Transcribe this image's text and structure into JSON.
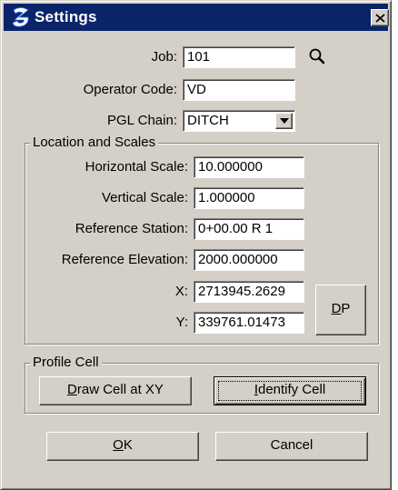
{
  "window": {
    "title": "Settings",
    "icon": "app-logo-icon",
    "close_icon": "close-icon"
  },
  "fields": {
    "job": {
      "label": "Job:",
      "value": "101",
      "icon": "search-icon"
    },
    "operator_code": {
      "label": "Operator Code:",
      "value": "VD"
    },
    "pgl_chain": {
      "label": "PGL Chain:",
      "value": "DITCH",
      "icon": "dropdown-arrow-icon"
    }
  },
  "location_and_scales": {
    "title": "Location and Scales",
    "horizontal_scale": {
      "label": "Horizontal Scale:",
      "value": "10.000000"
    },
    "vertical_scale": {
      "label": "Vertical Scale:",
      "value": "1.000000"
    },
    "reference_station": {
      "label": "Reference Station:",
      "value": "0+00.00 R 1"
    },
    "reference_elevation": {
      "label": "Reference Elevation:",
      "value": "2000.000000"
    },
    "x": {
      "label": "X:",
      "value": "2713945.2629"
    },
    "y": {
      "label": "Y:",
      "value": "339761.01473"
    },
    "dp_button": {
      "mnemonic": "D",
      "rest": "P"
    }
  },
  "profile_cell": {
    "title": "Profile Cell",
    "draw_cell_button": {
      "mnemonic": "D",
      "rest": "raw Cell at XY"
    },
    "identify_cell_button": {
      "mnemonic": "I",
      "rest": "dentify Cell"
    }
  },
  "buttons": {
    "ok": {
      "mnemonic": "O",
      "rest": "K"
    },
    "cancel": "Cancel"
  },
  "colors": {
    "title_bar": "#0a246a",
    "face": "#d4d0c8"
  }
}
